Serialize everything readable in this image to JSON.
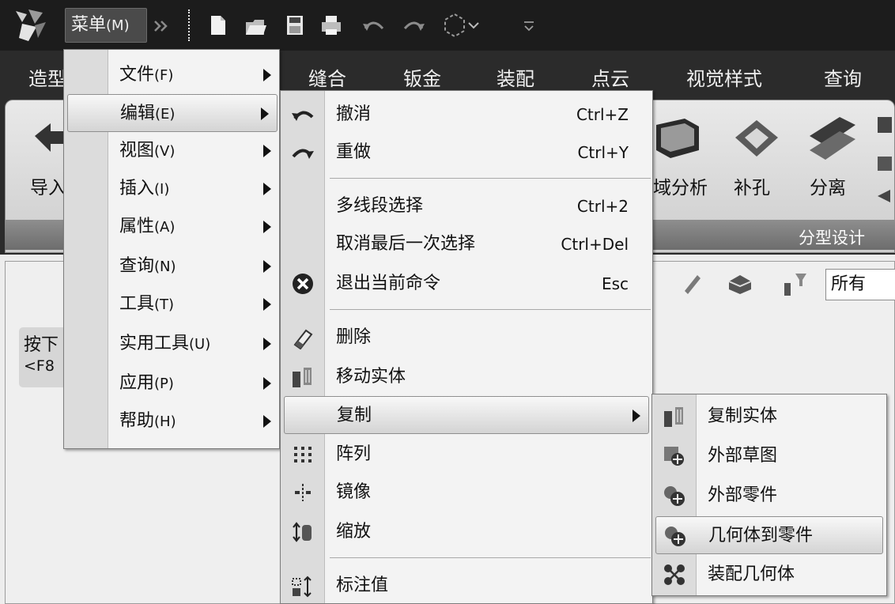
{
  "titlebar": {
    "menu_label": "菜单",
    "menu_accel": "(M)",
    "icons": [
      "app-logo",
      "overflow-chevrons",
      "new-file",
      "open-file",
      "save",
      "print",
      "undo",
      "redo",
      "select-shape",
      "customize-dropdown"
    ]
  },
  "tabs": [
    "造型",
    "缝合",
    "钣金",
    "装配",
    "点云",
    "视觉样式",
    "查询"
  ],
  "ribbon": {
    "labels": [
      "导入",
      "域分析",
      "补孔",
      "分离"
    ],
    "group_title": "分型设计"
  },
  "workspace": {
    "filter_value": "所有",
    "hint_line1": "按下",
    "hint_line2": "<F8"
  },
  "main_menu": {
    "items": [
      {
        "label": "文件",
        "accel": "(F)"
      },
      {
        "label": "编辑",
        "accel": "(E)"
      },
      {
        "label": "视图",
        "accel": "(V)"
      },
      {
        "label": "插入",
        "accel": "(I)"
      },
      {
        "label": "属性",
        "accel": "(A)"
      },
      {
        "label": "查询",
        "accel": "(N)"
      },
      {
        "label": "工具",
        "accel": "(T)"
      },
      {
        "label": "实用工具",
        "accel": "(U)"
      },
      {
        "label": "应用",
        "accel": "(P)"
      },
      {
        "label": "帮助",
        "accel": "(H)"
      }
    ]
  },
  "edit_menu": {
    "items": [
      {
        "label": "撤消",
        "shortcut": "Ctrl+Z",
        "icon": "undo-icon"
      },
      {
        "label": "重做",
        "shortcut": "Ctrl+Y",
        "icon": "redo-icon"
      },
      {
        "label": "多线段选择",
        "shortcut": "Ctrl+2",
        "icon": ""
      },
      {
        "label": "取消最后一次选择",
        "shortcut": "Ctrl+Del",
        "icon": ""
      },
      {
        "label": "退出当前命令",
        "shortcut": "Esc",
        "icon": "cancel-icon"
      },
      {
        "label": "删除",
        "shortcut": "",
        "icon": "eraser-icon"
      },
      {
        "label": "移动实体",
        "shortcut": "",
        "icon": "move-solid-icon"
      },
      {
        "label": "复制",
        "shortcut": "",
        "icon": ""
      },
      {
        "label": "阵列",
        "shortcut": "",
        "icon": "pattern-icon"
      },
      {
        "label": "镜像",
        "shortcut": "",
        "icon": "mirror-icon"
      },
      {
        "label": "缩放",
        "shortcut": "",
        "icon": "scale-icon"
      },
      {
        "label": "标注值",
        "shortcut": "",
        "icon": "dimension-value-icon"
      }
    ]
  },
  "copy_menu": {
    "items": [
      {
        "label": "复制实体",
        "icon": "copy-solid-icon"
      },
      {
        "label": "外部草图",
        "icon": "external-sketch-icon"
      },
      {
        "label": "外部零件",
        "icon": "external-part-icon"
      },
      {
        "label": "几何体到零件",
        "icon": "geometry-to-part-icon"
      },
      {
        "label": "装配几何体",
        "icon": "assembly-geometry-icon"
      }
    ]
  },
  "colors": {
    "titlebar_bg": "#1c1c1c",
    "tabbar_bg": "#2b2b2b",
    "menu_bg": "#f3f3f3",
    "menu_gutter": "#dcdcdc",
    "highlight": "#d4d4d4"
  }
}
